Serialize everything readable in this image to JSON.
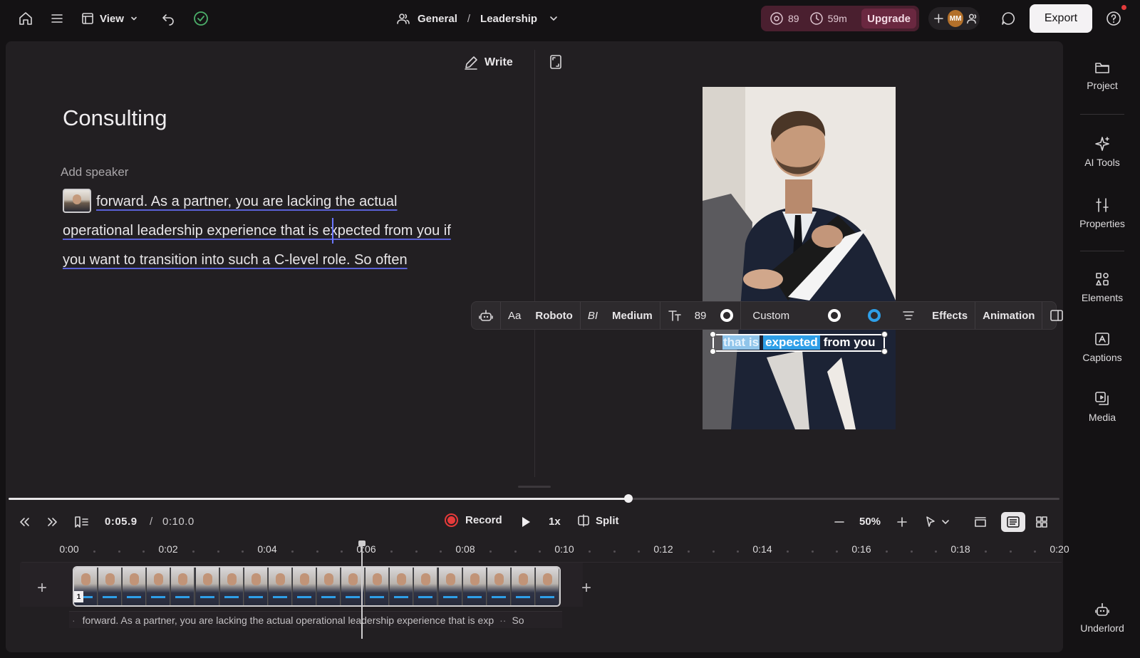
{
  "topbar": {
    "view_label": "View",
    "breadcrumb_group": "General",
    "breadcrumb_sep": "/",
    "breadcrumb_project": "Leadership",
    "credits_count": "89",
    "minutes_left": "59m",
    "upgrade_label": "Upgrade",
    "avatar_initials": "MM",
    "export_label": "Export"
  },
  "editor": {
    "write_label": "Write",
    "doc_title": "Consulting",
    "add_speaker_label": "Add speaker",
    "transcript_lines": [
      "forward. As a partner, you are lacking the actual",
      "operational leadership experience that is expected from you if",
      "you want to transition into such a C-level role. So often"
    ]
  },
  "caption_preview": {
    "selected_words": "that is",
    "highlight_word": "expected",
    "tail_words": "from you"
  },
  "text_toolbar": {
    "case_label": "Aa",
    "font_name": "Roboto",
    "bold_italic_label": "BI",
    "font_weight": "Medium",
    "font_size": "89",
    "color_preset": "Custom",
    "effects_label": "Effects",
    "animation_label": "Animation"
  },
  "right_rail": [
    {
      "label": "Project",
      "icon": "folder-icon"
    },
    {
      "label": "AI Tools",
      "icon": "sparkle-icon"
    },
    {
      "label": "Properties",
      "icon": "sliders-icon"
    },
    {
      "label": "Elements",
      "icon": "shapes-icon"
    },
    {
      "label": "Captions",
      "icon": "captions-icon"
    },
    {
      "label": "Media",
      "icon": "media-icon"
    },
    {
      "label": "Underlord",
      "icon": "robot-icon"
    }
  ],
  "playback": {
    "current_time": "0:05.9",
    "separator": "/",
    "total_time": "0:10.0",
    "record_label": "Record",
    "speed": "1x",
    "split_label": "Split",
    "zoom": "50%",
    "progress": 0.59
  },
  "timeline": {
    "ruler_labels": [
      "0:00",
      "0:02",
      "0:04",
      "0:06",
      "0:08",
      "0:10",
      "0:12",
      "0:14",
      "0:16",
      "0:18",
      "0:20"
    ],
    "clip_number": "1",
    "transcript_strip": "forward. As a partner, you are lacking the actual operational leadership experience that is exp",
    "transcript_strip_tail": "So"
  },
  "colors": {
    "accent_blue": "#2e9fe8",
    "record_red": "#e53a3a",
    "upgrade_bg": "#4a1f2f",
    "underline": "#5a61d6"
  }
}
